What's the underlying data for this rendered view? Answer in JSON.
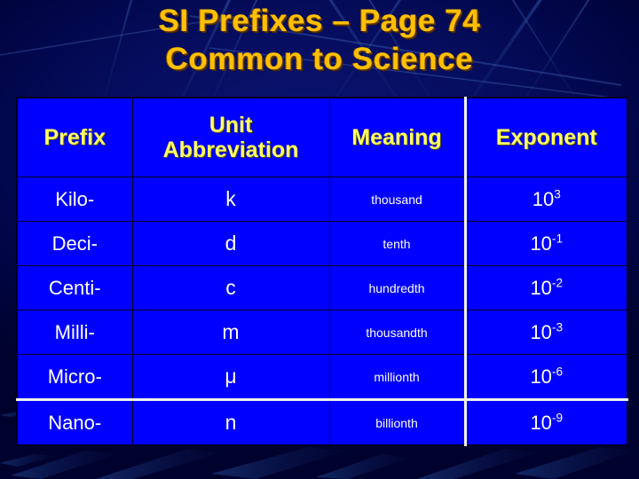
{
  "slide": {
    "title_line_1": "SI Prefixes – Page 74",
    "title_line_2": "Common to Science",
    "colors": {
      "background": "#000033",
      "title_text": "#FFC000",
      "table_fill": "#0000FF",
      "header_text": "#FFFF66",
      "body_text": "#FFFFFF",
      "separator_line": "#F2F2E8"
    }
  },
  "table": {
    "headers": {
      "prefix": "Prefix",
      "abbreviation_line_1": "Unit",
      "abbreviation_line_2": "Abbreviation",
      "meaning": "Meaning",
      "exponent": "Exponent"
    },
    "rows": [
      {
        "prefix": "Kilo-",
        "abbreviation": "k",
        "meaning": "thousand",
        "exponent_base": "10",
        "exponent_power": "3"
      },
      {
        "prefix": "Deci-",
        "abbreviation": "d",
        "meaning": "tenth",
        "exponent_base": "10",
        "exponent_power": "-1"
      },
      {
        "prefix": "Centi-",
        "abbreviation": "c",
        "meaning": "hundredth",
        "exponent_base": "10",
        "exponent_power": "-2"
      },
      {
        "prefix": "Milli-",
        "abbreviation": "m",
        "meaning": "thousandth",
        "exponent_base": "10",
        "exponent_power": "-3"
      },
      {
        "prefix": "Micro-",
        "abbreviation": "μ",
        "meaning": "millionth",
        "exponent_base": "10",
        "exponent_power": "-6"
      },
      {
        "prefix": "Nano-",
        "abbreviation": "n",
        "meaning": "billionth",
        "exponent_base": "10",
        "exponent_power": "-9"
      }
    ]
  }
}
